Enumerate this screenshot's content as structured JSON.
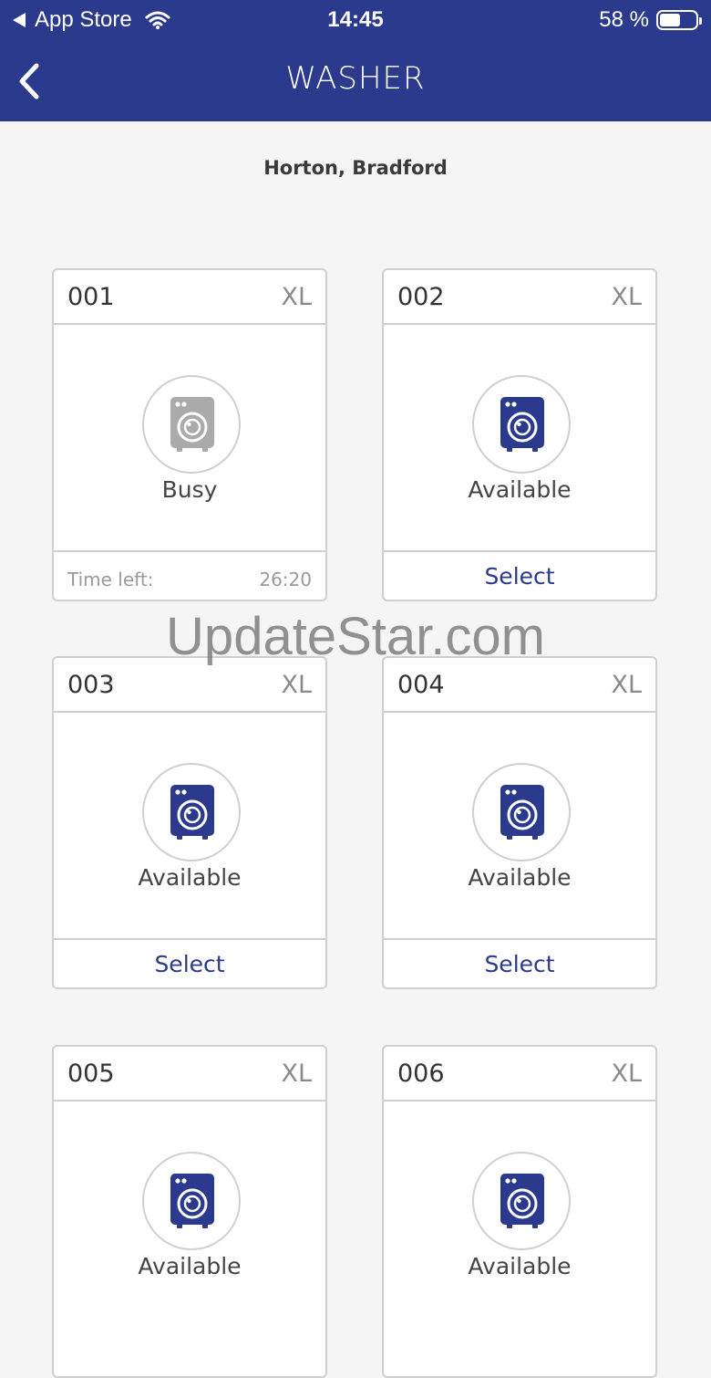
{
  "status_bar": {
    "back_app": "App Store",
    "time": "14:45",
    "battery_text": "58 %",
    "battery_level": 0.58
  },
  "nav": {
    "title": "WASHER",
    "back_icon": "chevron-left-icon"
  },
  "location": "Horton, Bradford",
  "colors": {
    "brand": "#2b3a8c",
    "busy_icon": "#aaaaaa",
    "available_icon": "#2b3a8c"
  },
  "machines": [
    {
      "number": "001",
      "size": "XL",
      "status": "Busy",
      "time_left_label": "Time left:",
      "time_left": "26:20",
      "icon": "washing-machine-icon"
    },
    {
      "number": "002",
      "size": "XL",
      "status": "Available",
      "action": "Select",
      "icon": "washing-machine-icon"
    },
    {
      "number": "003",
      "size": "XL",
      "status": "Available",
      "action": "Select",
      "icon": "washing-machine-icon"
    },
    {
      "number": "004",
      "size": "XL",
      "status": "Available",
      "action": "Select",
      "icon": "washing-machine-icon"
    },
    {
      "number": "005",
      "size": "XL",
      "status": "Available",
      "icon": "washing-machine-icon"
    },
    {
      "number": "006",
      "size": "XL",
      "status": "Available",
      "icon": "washing-machine-icon"
    }
  ],
  "watermark": "UpdateStar.com"
}
